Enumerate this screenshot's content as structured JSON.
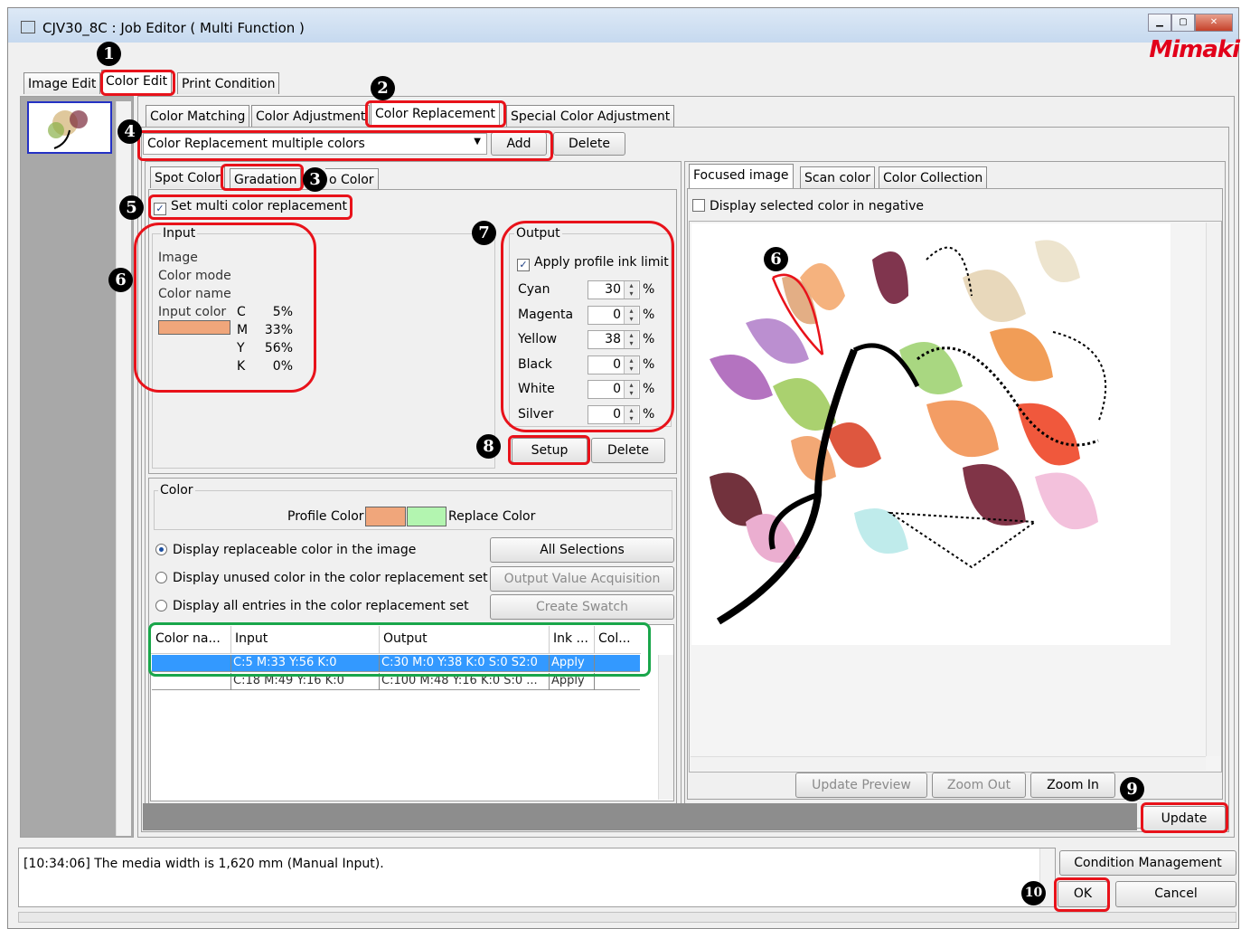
{
  "window": {
    "title": "CJV30_8C : Job Editor ( Multi Function )",
    "brand": "Mimaki"
  },
  "main_tabs": [
    "Image Edit",
    "Color Edit",
    "Print Condition"
  ],
  "sub_tabs": [
    "Color Matching",
    "Color Adjustment",
    "Color Replacement",
    "Special Color Adjustment"
  ],
  "replacement_set": {
    "selected": "Color Replacement multiple colors",
    "add": "Add",
    "delete": "Delete"
  },
  "inner_tabs": [
    "Spot Color",
    "Gradation",
    "o Color"
  ],
  "multi": {
    "label": "Set multi color replacement",
    "checked": true
  },
  "input": {
    "title": "Input",
    "image_label": "Image",
    "mode_label": "Color mode",
    "name_label": "Color name",
    "color_label": "Input color",
    "swatch": "#f0a67b",
    "values": [
      {
        "ch": "C",
        "v": "5%"
      },
      {
        "ch": "M",
        "v": "33%"
      },
      {
        "ch": "Y",
        "v": "56%"
      },
      {
        "ch": "K",
        "v": "0%"
      }
    ]
  },
  "output": {
    "title": "Output",
    "apply_label": "Apply profile ink limit",
    "apply_checked": true,
    "rows": [
      {
        "name": "Cyan",
        "value": "30",
        "unit": "%"
      },
      {
        "name": "Magenta",
        "value": "0",
        "unit": "%"
      },
      {
        "name": "Yellow",
        "value": "38",
        "unit": "%"
      },
      {
        "name": "Black",
        "value": "0",
        "unit": "%"
      },
      {
        "name": "White",
        "value": "0",
        "unit": "%"
      },
      {
        "name": "Silver",
        "value": "0",
        "unit": "%"
      }
    ],
    "setup": "Setup",
    "delete": "Delete"
  },
  "color": {
    "title": "Color",
    "profile_label": "Profile Color",
    "replace_label": "Replace Color",
    "profile_swatch": "#f0a67b",
    "replace_swatch": "#b3f5b0"
  },
  "radios": [
    {
      "label": "Display replaceable color in the image",
      "selected": true
    },
    {
      "label": "Display unused color in the color replacement set",
      "selected": false
    },
    {
      "label": "Display all entries in the color replacement set",
      "selected": false
    }
  ],
  "side_buttons": [
    "All Selections",
    "Output Value Acquisition",
    "Create Swatch"
  ],
  "table": {
    "headers": [
      "Color na...",
      "Input",
      "Output",
      "Ink ...",
      "Col..."
    ],
    "rows": [
      [
        "",
        "C:5 M:33 Y:56 K:0",
        "C:30 M:0 Y:38 K:0 S:0 S2:0",
        "Apply",
        ""
      ],
      [
        "",
        "C:18 M:49 Y:16 K:0",
        "C:100 M:48 Y:16 K:0 S:0 ...",
        "Apply",
        ""
      ]
    ]
  },
  "preview_tabs": [
    "Focused image",
    "Scan color",
    "Color Collection"
  ],
  "negative": {
    "label": "Display selected color in negative",
    "checked": false
  },
  "preview_buttons": [
    "Update Preview",
    "Zoom Out",
    "Zoom In"
  ],
  "update": "Update",
  "log": "[10:34:06] The media width is 1,620 mm (Manual Input).",
  "bottom_buttons": {
    "condition": "Condition Management",
    "ok": "OK",
    "cancel": "Cancel"
  },
  "callouts": [
    "1",
    "2",
    "3",
    "4",
    "5",
    "6",
    "6",
    "7",
    "8",
    "9",
    "10"
  ]
}
